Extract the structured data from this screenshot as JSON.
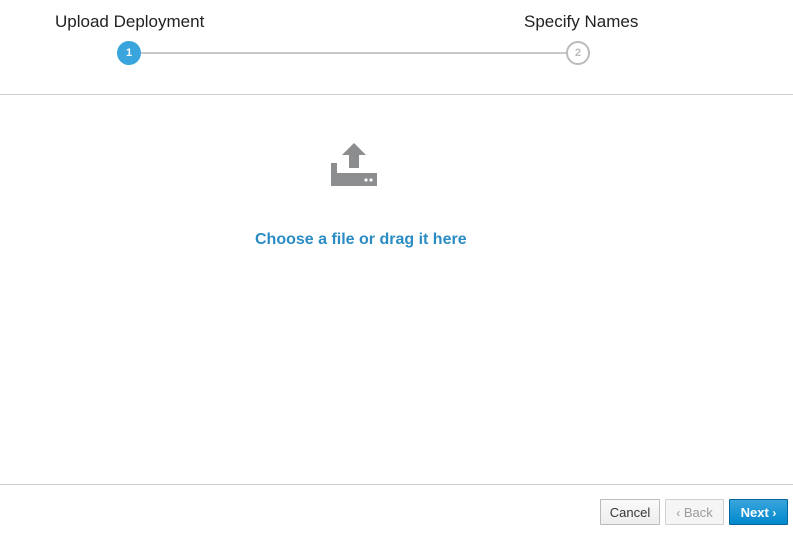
{
  "steps": [
    {
      "title": "Upload Deployment",
      "number": "1",
      "state": "active"
    },
    {
      "title": "Specify Names",
      "number": "2",
      "state": "inactive"
    }
  ],
  "content": {
    "icon": "upload-icon",
    "choose_link": "Choose a file or drag it here"
  },
  "footer": {
    "cancel_label": "Cancel",
    "back_label": "Back",
    "back_chevron": "‹",
    "next_label": "Next",
    "next_chevron": "›"
  },
  "colors": {
    "accent": "#39a5dc",
    "link": "#2b8cc4",
    "icon": "#8b8d8f",
    "step_inactive": "#bbbbbb"
  }
}
